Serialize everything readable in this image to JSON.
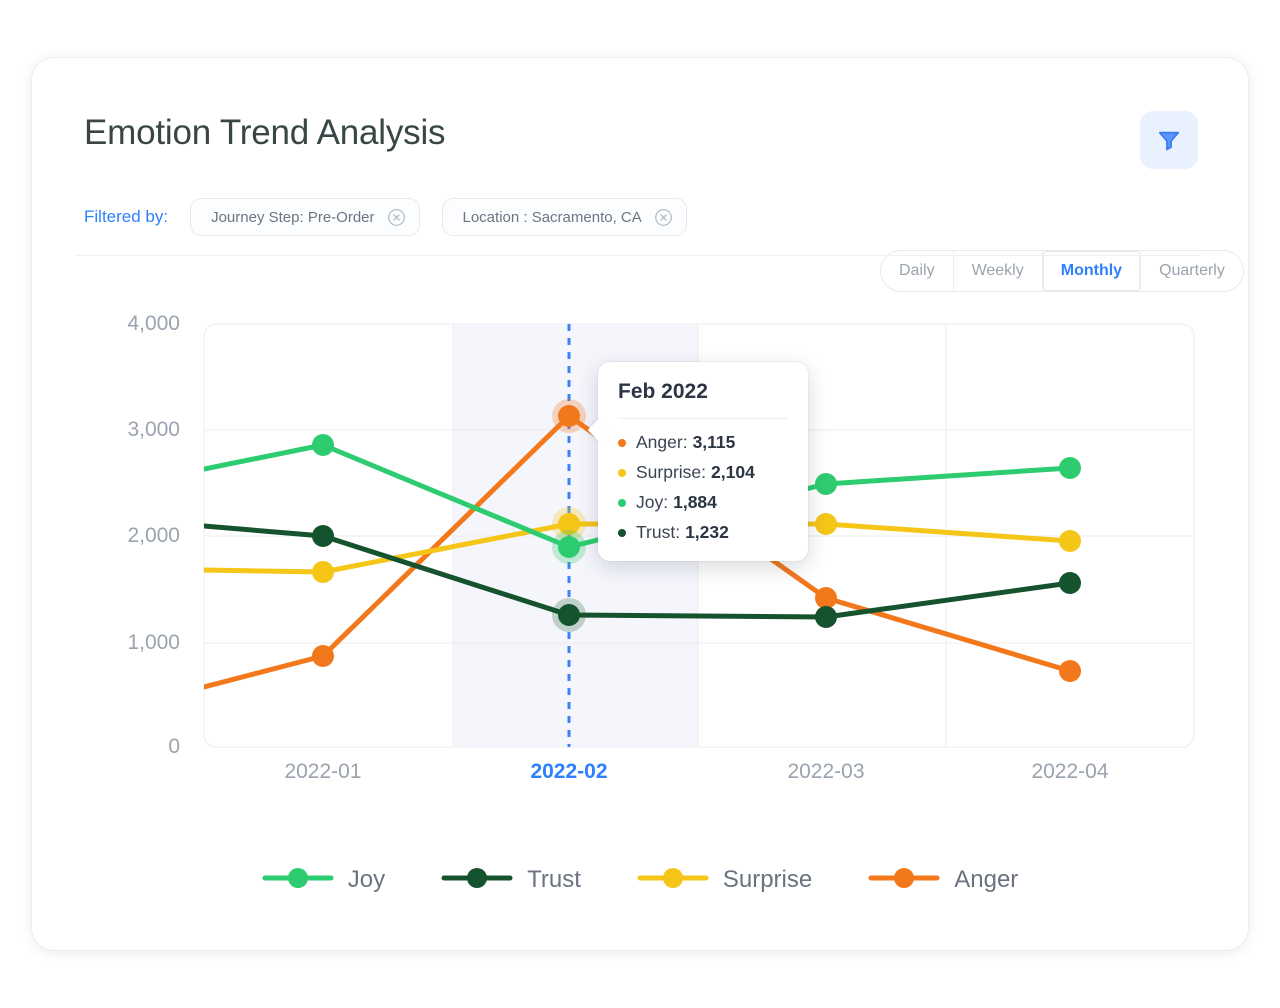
{
  "header": {
    "title": "Emotion Trend Analysis",
    "filter_button_icon": "funnel-icon"
  },
  "filters": {
    "label": "Filtered by:",
    "chips": [
      {
        "label": "Journey Step: Pre-Order",
        "remove_icon": "close-circle-icon"
      },
      {
        "label": "Location : Sacramento, CA",
        "remove_icon": "close-circle-icon"
      }
    ]
  },
  "granularity": {
    "options": [
      "Daily",
      "Weekly",
      "Monthly",
      "Quarterly"
    ],
    "selected": "Monthly"
  },
  "tooltip": {
    "title": "Feb 2022",
    "rows": [
      {
        "name": "Anger:",
        "value": "3,115",
        "color": "#f3781b"
      },
      {
        "name": "Surprise:",
        "value": "2,104",
        "color": "#f5c518"
      },
      {
        "name": "Joy:",
        "value": "1,884",
        "color": "#2ecc71"
      },
      {
        "name": "Trust:",
        "value": "1,232",
        "color": "#14532d"
      }
    ]
  },
  "legend": [
    {
      "label": "Joy",
      "color": "#2ecc71"
    },
    {
      "label": "Trust",
      "color": "#14532d"
    },
    {
      "label": "Surprise",
      "color": "#f5c518"
    },
    {
      "label": "Anger",
      "color": "#f3781b"
    }
  ],
  "colors": {
    "joy": "#2ecc71",
    "trust": "#14532d",
    "surprise": "#f5c518",
    "anger": "#f3781b",
    "accent": "#2f80ff",
    "grid": "#ececec",
    "highlight_band": "#f5f6fc",
    "axis_text": "#9aa3ae"
  },
  "chart_data": {
    "type": "line",
    "title": "Emotion Trend Analysis",
    "xlabel": "",
    "ylabel": "",
    "categories": [
      "2022-01",
      "2022-02",
      "2022-03",
      "2022-04"
    ],
    "highlighted_category": "2022-02",
    "ylim": [
      0,
      4000
    ],
    "yticks": [
      0,
      1000,
      2000,
      3000,
      4000
    ],
    "ytick_labels": [
      "0",
      "1,000",
      "2,000",
      "3,000",
      "4,000"
    ],
    "grid": true,
    "legend_position": "bottom",
    "series": [
      {
        "name": "Joy",
        "color": "#2ecc71",
        "values": [
          2850,
          1884,
          2480,
          2630
        ]
      },
      {
        "name": "Trust",
        "color": "#14532d",
        "values": [
          1980,
          1232,
          1210,
          1530
        ]
      },
      {
        "name": "Surprise",
        "color": "#f5c518",
        "values": [
          1650,
          2104,
          2100,
          1940
        ]
      },
      {
        "name": "Anger",
        "color": "#f3781b",
        "values": [
          855,
          3115,
          1400,
          710
        ]
      }
    ],
    "annotations": {
      "hover_marker": "2022-02",
      "hover_line_style": "dashed",
      "hover_line_color": "#2f80ff"
    }
  }
}
